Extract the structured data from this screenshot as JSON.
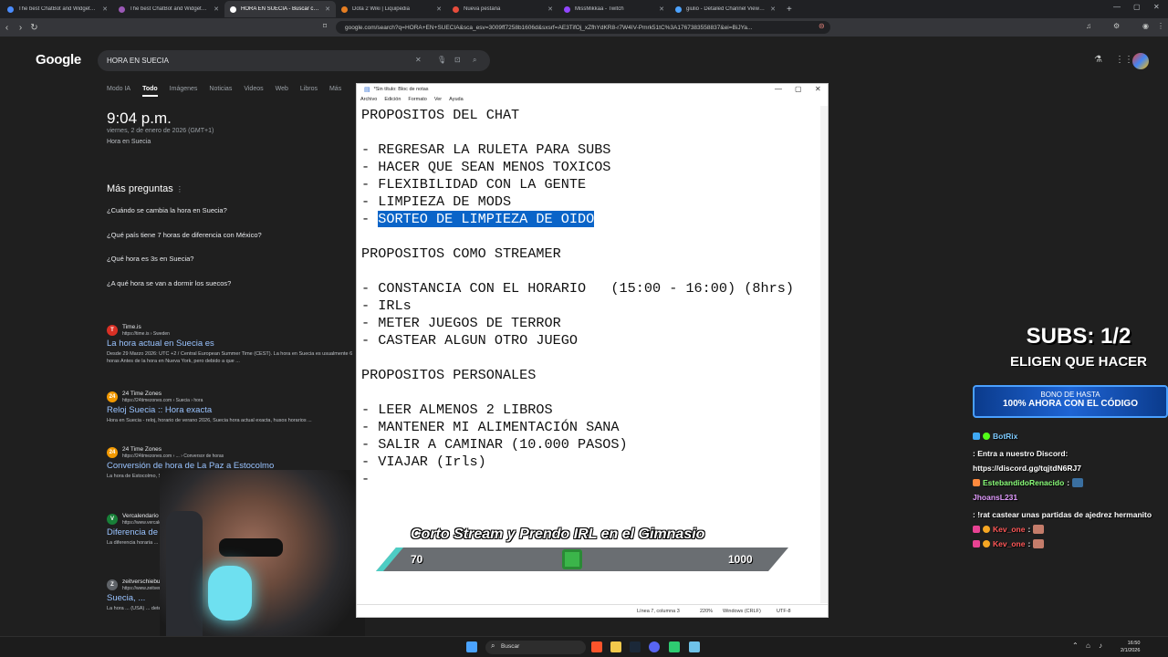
{
  "browser": {
    "tabs": [
      {
        "label": "The best ChatBot and Widgets for Kick",
        "color": "#4a8cff"
      },
      {
        "label": "The best ChatBot and Widgets for Kick",
        "color": "#9b59b6"
      },
      {
        "label": "HORA EN SUECIA - Buscar con Google",
        "color": "#ffffff",
        "active": true
      },
      {
        "label": "Dota 2 Wiki | Liquipedia",
        "color": "#e67e22"
      },
      {
        "label": "Nueva pestaña",
        "color": "#e74c3c"
      },
      {
        "label": "MissMikkaa - Twitch",
        "color": "#9146ff"
      },
      {
        "label": "giulio - Detailed Channel Viewership",
        "color": "#4da3ff"
      }
    ],
    "url": "google.com/search?q=HORA+EN+SUECIA&sca_esv=3009ff7258b1606d&sxsrf=AE3TifOj_xZfhYdKR8-r7W4IV-Pmrk51tC%3A1767383558837&ei=BiJYa..."
  },
  "google": {
    "logo": "Google",
    "query": "HORA EN SUECIA",
    "tabs": [
      "Modo IA",
      "Todo",
      "Imágenes",
      "Noticias",
      "Videos",
      "Web",
      "Libros",
      "Más"
    ],
    "active_tab": "Todo",
    "time": "9:04 p.m.",
    "date": "viernes, 2 de enero de 2026 (GMT+1)",
    "place": "Hora en Suecia",
    "faq_title": "Más preguntas",
    "faq": [
      "¿Cuándo se cambia la hora en Suecia?",
      "¿Qué país tiene 7 horas de diferencia con México?",
      "¿Qué hora es 3s en Suecia?",
      "¿A qué hora se van a dormir los suecos?"
    ],
    "results": [
      {
        "name": "Time.is",
        "url": "https://time.is › Sweden",
        "title": "La hora actual en Suecia es",
        "snippet": "Desde 29 Marzo 2026: UTC +2 / Central European Summer Time (CEST). La hora en Suecia es usualmente 6 horas Antes de la hora en Nueva York, pero debido a que ...",
        "color": "#d93025",
        "letter": "T"
      },
      {
        "name": "24 Time Zones",
        "url": "https://24timezones.com › Suecia › hora",
        "title": "Reloj Suecia :: Hora exacta",
        "snippet": "Hora en Suecia - reloj, horario de verano 2026, Suecia hora actual exacta, husos horarios ...",
        "color": "#f29900",
        "letter": "24"
      },
      {
        "name": "24 Time Zones",
        "url": "https://24timezones.com › ... › Conversor de horas",
        "title": "Conversión de hora de La Paz a Estocolmo",
        "snippet": "La hora de Estocolmo, Suecia ... La Paz, Bolivia. Conversor de ... Conversor de hora de La Paz",
        "color": "#f29900",
        "letter": "24"
      },
      {
        "name": "Vercalendario",
        "url": "https://www.vercalendario...",
        "title": "Diferencia de ...",
        "snippet": "La diferencia horaria ... en Bolivia la hora 20:00, en Suecia ...",
        "color": "#188038",
        "letter": "V"
      },
      {
        "name": "zeitverschiebung",
        "url": "https://www.zeitverschiebung...",
        "title": "Suecia, ...",
        "snippet": "La hora ... (USA) ... determinar ...",
        "color": "#5f6368",
        "letter": "Z"
      }
    ]
  },
  "notepad": {
    "title": "*Sin título: Bloc de notas",
    "menu": [
      "Archivo",
      "Edición",
      "Formato",
      "Ver",
      "Ayuda"
    ],
    "lines": [
      "PROPOSITOS DEL CHAT",
      "",
      "- REGRESAR LA RULETA PARA SUBS",
      "- HACER QUE SEAN MENOS TOXICOS",
      "- FLEXIBILIDAD CON LA GENTE",
      "- LIMPIEZA DE MODS",
      "- ",
      "",
      "PROPOSITOS COMO STREAMER",
      "",
      "- CONSTANCIA CON EL HORARIO   (15:00 - 16:00) (8hrs)",
      "- IRLs",
      "- METER JUEGOS DE TERROR",
      "- CASTEAR ALGUN OTRO JUEGO",
      "",
      "PROPOSITOS PERSONALES",
      "",
      "- LEER ALMENOS 2 LIBROS",
      "- MANTENER MI ALIMENTACIÓN SANA",
      "- SALIR A CAMINAR (10.000 PASOS)",
      "- VIAJAR (Irls)",
      "-"
    ],
    "selected_text": "SORTEO DE LIMPIEZA DE OIDO",
    "status": {
      "pos": "Línea 7, columna 3",
      "zoom": "220%",
      "eol": "Windows (CRLF)",
      "enc": "UTF-8"
    }
  },
  "overlay": {
    "goal_title": "Corto Stream y Prendo IRL en el Gimnasio",
    "current": "70",
    "target": "1000",
    "progress_fraction": 0.07
  },
  "stream": {
    "subs": "SUBS: 1/2",
    "subs_sub": "ELIGEN QUE HACER",
    "bono_a": "BONO DE HASTA",
    "bono_b": "100% AHORA CON EL CÓDIGO",
    "chat": [
      {
        "user": "BotRix",
        "color": "#7ecbff",
        "text": ": Entra a nuestro Discord: https://discord.gg/tqjtdN6RJ7"
      },
      {
        "user": "EstebandidoRenacido",
        "color": "#8bff7a",
        "text": ":"
      },
      {
        "user": "JhoansL231",
        "color": "#e29cff",
        "text": ": !rat castear unas partidas de ajedrez hermanito"
      },
      {
        "user": "Kev_one",
        "color": "#ff5757",
        "text": ":"
      },
      {
        "user": "Kev_one",
        "color": "#ff5757",
        "text": ":"
      }
    ]
  },
  "taskbar": {
    "search": "Buscar",
    "time": "16:50",
    "date": "2/1/2026"
  }
}
